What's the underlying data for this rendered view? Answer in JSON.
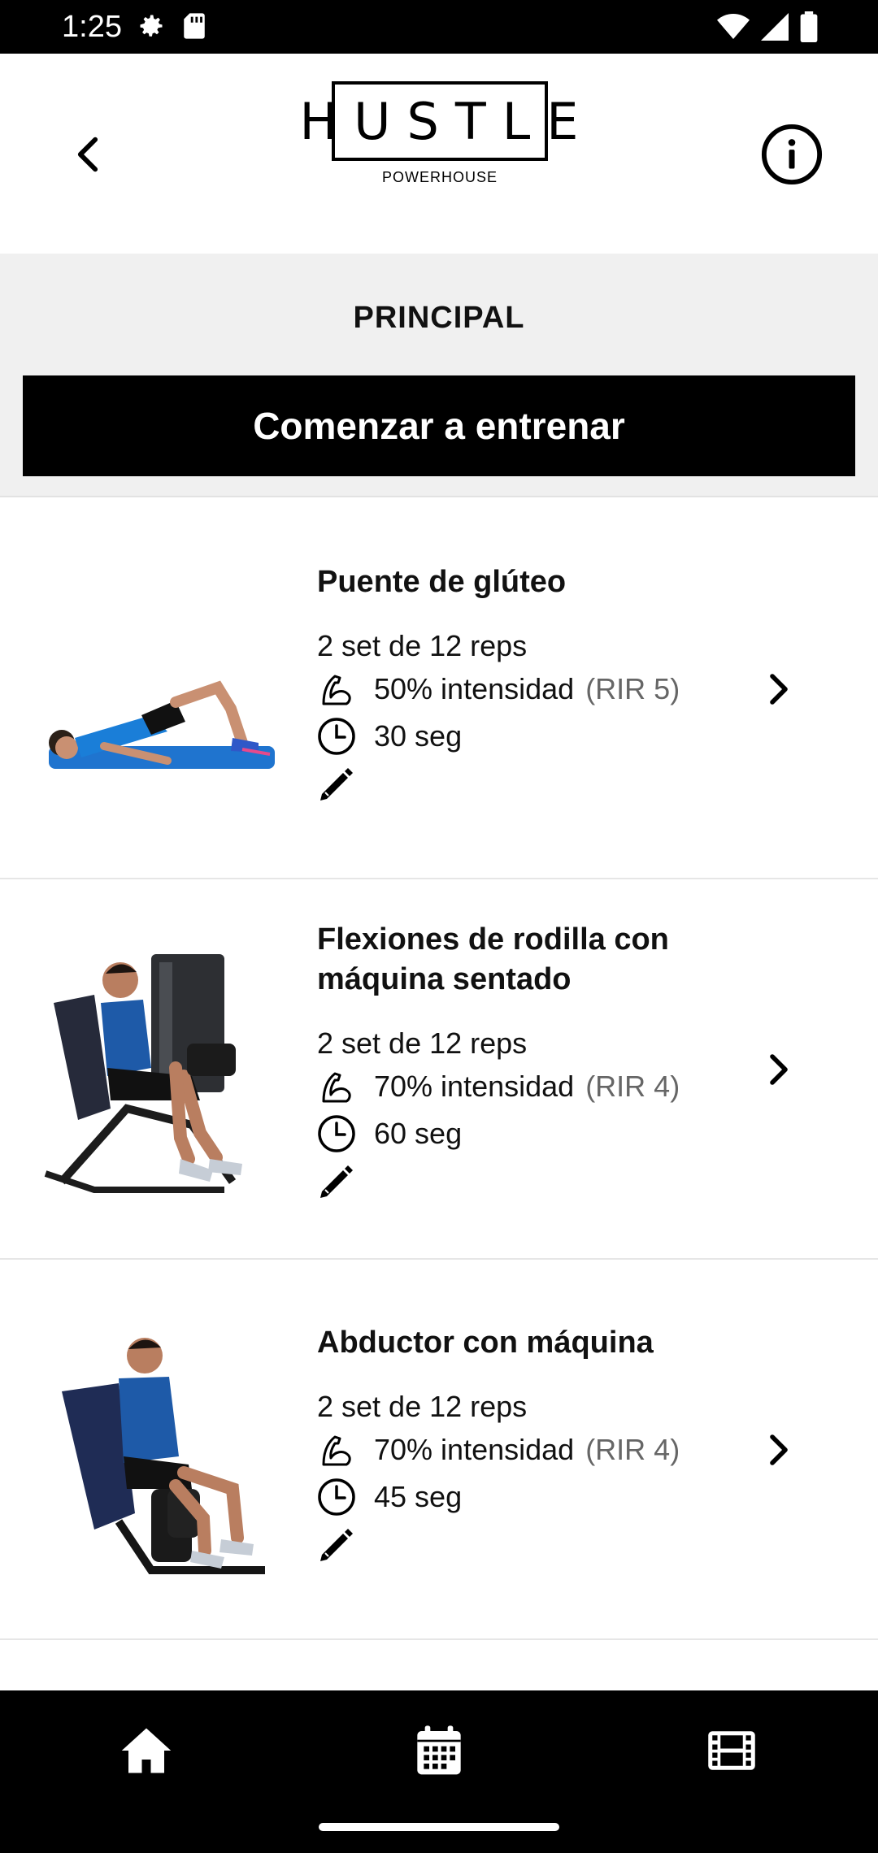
{
  "status_bar": {
    "time": "1:25",
    "left_icons": [
      "gear-icon",
      "sd-card-icon"
    ],
    "right_icons": [
      "wifi-icon",
      "signal-icon",
      "battery-icon"
    ]
  },
  "header": {
    "logo_main": "HUSTLE",
    "logo_sub": "POWERHOUSE",
    "back_icon": "chevron-left-icon",
    "info_icon": "info-circle-icon"
  },
  "section": {
    "title": "PRINCIPAL",
    "start_button_label": "Comenzar a entrenar"
  },
  "exercises": [
    {
      "name": "Puente de glúteo",
      "sets": "2 set de 12 reps",
      "intensity": "50% intensidad",
      "rir": "(RIR 5)",
      "rest": "30 seg",
      "image": "glute-bridge-figure"
    },
    {
      "name": "Flexiones de rodilla con máquina sentado",
      "sets": "2 set de 12 reps",
      "intensity": "70% intensidad",
      "rir": "(RIR 4)",
      "rest": "60 seg",
      "image": "seated-leg-curl-machine-figure"
    },
    {
      "name": "Abductor con máquina",
      "sets": "2 set de 12 reps",
      "intensity": "70% intensidad",
      "rir": "(RIR 4)",
      "rest": "45 seg",
      "image": "abductor-machine-figure"
    }
  ],
  "bottom_nav": {
    "items": [
      "home-icon",
      "calendar-icon",
      "film-icon"
    ]
  },
  "colors": {
    "primary": "#000000",
    "section_bg": "#f0f0f0",
    "muted_text": "#666666"
  }
}
